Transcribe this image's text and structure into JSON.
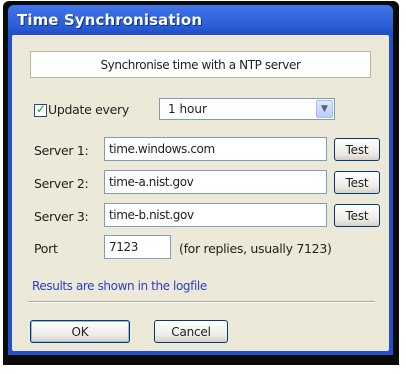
{
  "window": {
    "title": "Time Synchronisation"
  },
  "info": {
    "text": "Synchronise time with a NTP server"
  },
  "update": {
    "checked": true,
    "label": "Update every",
    "interval_selected": "1 hour"
  },
  "servers": [
    {
      "label": "Server 1:",
      "value": "time.windows.com",
      "test_label": "Test"
    },
    {
      "label": "Server 2:",
      "value": "time-a.nist.gov",
      "test_label": "Test"
    },
    {
      "label": "Server 3:",
      "value": "time-b.nist.gov",
      "test_label": "Test"
    }
  ],
  "port": {
    "label": "Port",
    "value": "7123",
    "hint": "(for replies, usually 7123)"
  },
  "log_link": "Results are shown in the logfile",
  "buttons": {
    "ok": "OK",
    "cancel": "Cancel"
  },
  "colors": {
    "titlebar": "#2150c8",
    "dialog_bg": "#ece9d8",
    "link": "#2a3ec8"
  },
  "icons": {
    "checkbox_tick": "check-icon",
    "dropdown_arrow": "chevron-down-icon"
  }
}
